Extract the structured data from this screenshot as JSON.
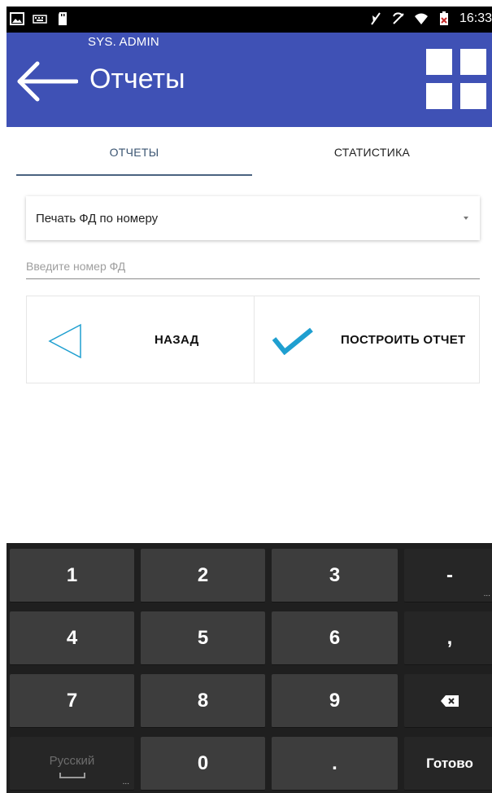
{
  "status_bar": {
    "time": "16:33",
    "left_icons": [
      "gallery-icon",
      "keyboard-icon",
      "sd-card-icon"
    ],
    "right_icons": [
      "mute-icon",
      "no-sync-icon",
      "wifi-icon",
      "battery-icon"
    ]
  },
  "app_bar": {
    "user": "SYS. ADMIN",
    "title": "Отчеты",
    "color": "#3f51b5"
  },
  "tabs": [
    {
      "label": "ОТЧЕТЫ",
      "selected": true
    },
    {
      "label": "СТАТИСТИКА",
      "selected": false
    }
  ],
  "report_select": {
    "value": "Печать ФД по номеру"
  },
  "fd_number_input": {
    "value": "",
    "placeholder": "Введите номер ФД"
  },
  "actions": {
    "back_label": "НАЗАД",
    "build_label": "ПОСТРОИТЬ ОТЧЕТ",
    "accent": "#1f9fd0"
  },
  "keyboard": {
    "keys": [
      "1",
      "2",
      "3",
      "-",
      "4",
      "5",
      "6",
      ",",
      "7",
      "8",
      "9",
      "0",
      "."
    ],
    "more_mark": "...",
    "language": "Русский",
    "done": "Готово"
  }
}
